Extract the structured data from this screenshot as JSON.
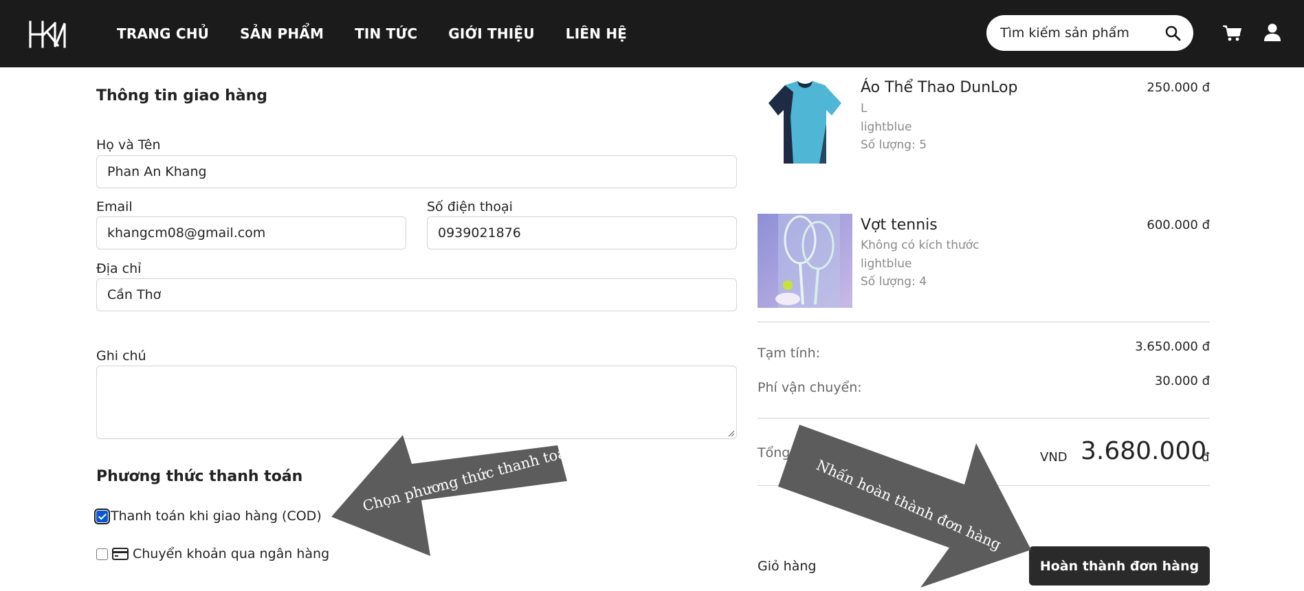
{
  "header": {
    "logo_text": "HKN",
    "nav": [
      "TRANG CHỦ",
      "SẢN PHẨM",
      "TIN TỨC",
      "GIỚI THIỆU",
      "LIÊN HỆ"
    ],
    "search_placeholder": "Tìm kiếm sản phẩm",
    "icons": [
      "search-icon",
      "cart-icon",
      "user-icon"
    ]
  },
  "shipping": {
    "title": "Thông tin giao hàng",
    "name_label": "Họ và Tên",
    "name_value": "Phan An Khang",
    "email_label": "Email",
    "email_value": "khangcm08@gmail.com",
    "phone_label": "Số điện thoại",
    "phone_value": "0939021876",
    "address_label": "Địa chỉ",
    "address_value": "Cần Thơ",
    "note_label": "Ghi chú",
    "note_value": ""
  },
  "payment": {
    "title": "Phương thức thanh toán",
    "options": [
      {
        "label": "Thanh toán khi giao hàng (COD)",
        "checked": true
      },
      {
        "label": "Chuyển khoản qua ngân hàng",
        "checked": false,
        "icon": "credit-card-icon"
      }
    ]
  },
  "order": {
    "items": [
      {
        "name": "Áo Thể Thao DunLop",
        "size": "L",
        "color": "lightblue",
        "quantity": "Số lượng: 5",
        "price": "250.000 đ"
      },
      {
        "name": "Vợt tennis",
        "size": "Không có kích thước",
        "color": "lightblue",
        "quantity": "Số lượng: 4",
        "price": "600.000 đ"
      }
    ],
    "subtotal_label": "Tạm tính:",
    "subtotal_value": "3.650.000 đ",
    "shipping_label": "Phí vận chuyển:",
    "shipping_value": "30.000 đ",
    "total_label": "Tổng",
    "total_currency": "VND",
    "total_value": "3.680.000",
    "total_suffix": "đ",
    "cart_link": "Giỏ hàng",
    "complete_button": "Hoàn thành đơn hàng"
  },
  "annotations": {
    "left_arrow_text": "Chọn phương thức thanh toán",
    "right_arrow_text": "Nhấn hoàn thành đơn hàng"
  },
  "colors": {
    "header_bg": "#1b1b1b",
    "button_bg": "#2a2a2a",
    "arrow_fill": "#5c5c5c"
  }
}
